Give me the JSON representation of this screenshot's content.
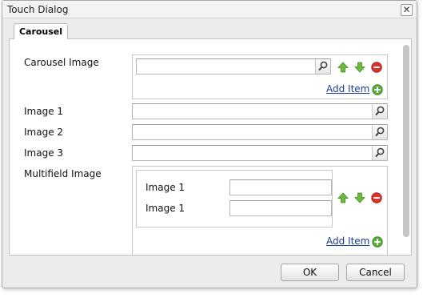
{
  "dialog": {
    "title": "Touch Dialog",
    "close_label": "✕",
    "tab_label": "Carousel"
  },
  "form": {
    "carousel_image": {
      "label": "Carousel Image",
      "value": "",
      "add_item_label": "Add Item"
    },
    "image1": {
      "label": "Image 1",
      "value": ""
    },
    "image2": {
      "label": "Image 2",
      "value": ""
    },
    "image3": {
      "label": "Image 3",
      "value": ""
    },
    "multifield_image": {
      "label": "Multifield Image",
      "items": [
        {
          "label": "Image 1",
          "value": ""
        },
        {
          "label": "Image 1",
          "value": ""
        }
      ],
      "add_item_label": "Add Item"
    }
  },
  "buttons": {
    "ok": "OK",
    "cancel": "Cancel"
  },
  "icons": {
    "search": "magnifier-icon",
    "move_up": "arrow-up-icon",
    "move_down": "arrow-down-icon",
    "remove": "remove-icon",
    "add": "add-icon"
  },
  "colors": {
    "link": "#1c3f94",
    "arrow_green": "#6fba3a",
    "remove_red": "#d9332b",
    "add_green": "#5cad3a"
  }
}
